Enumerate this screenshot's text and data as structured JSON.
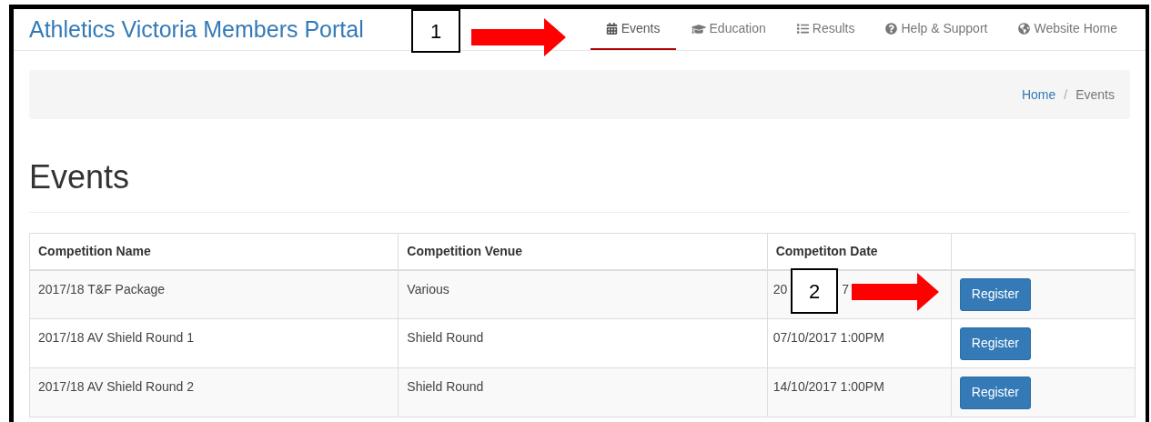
{
  "header": {
    "title": "Athletics Victoria Members Portal"
  },
  "nav": [
    {
      "label": "Events",
      "kind": "calendar",
      "selected": true
    },
    {
      "label": "Education",
      "kind": "cap",
      "selected": false
    },
    {
      "label": "Results",
      "kind": "list",
      "selected": false
    },
    {
      "label": "Help & Support",
      "kind": "question",
      "selected": false
    },
    {
      "label": "Website Home",
      "kind": "globe",
      "selected": false
    }
  ],
  "breadcrumb": {
    "separator": "/",
    "items": [
      {
        "label": "Home",
        "kind": "link"
      },
      {
        "label": "Events",
        "kind": "current"
      }
    ]
  },
  "heading": "Events",
  "table": {
    "columns": [
      "Competition Name",
      "Competition Venue",
      "Competiton Date"
    ],
    "rows": [
      {
        "name": "2017/18 T&F Package",
        "venue": "Various",
        "date_parts": [
          "20",
          "7"
        ],
        "button": "Register"
      },
      {
        "name": "2017/18 AV Shield Round 1",
        "venue": "Shield Round",
        "date_parts": [
          "07/10/2017 1:00PM"
        ],
        "button": "Register"
      },
      {
        "name": "2017/18 AV Shield Round 2",
        "venue": "Shield Round",
        "date_parts": [
          "14/10/2017 1:00PM"
        ],
        "button": "Register"
      }
    ]
  },
  "annotations": [
    {
      "label": "1"
    },
    {
      "label": "2"
    }
  ]
}
